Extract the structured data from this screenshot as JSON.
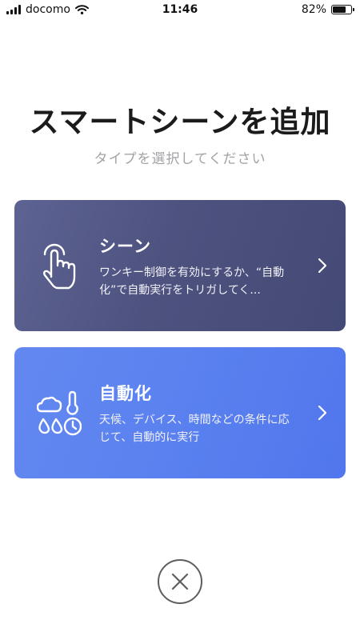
{
  "status_bar": {
    "carrier": "docomo",
    "time": "11:46",
    "battery_percent": "82%",
    "battery_level": 0.82,
    "signal_icon": "cellular-signal-icon",
    "wifi_icon": "wifi-icon",
    "battery_icon": "battery-icon"
  },
  "header": {
    "title": "スマートシーンを追加",
    "subtitle": "タイプを選択してください"
  },
  "cards": [
    {
      "title": "シーン",
      "description": "ワンキー制御を有効にするか、“自動化”で自動実行をトリガしてく...",
      "icon": "tap-hand-icon",
      "color": "#4e527f"
    },
    {
      "title": "自動化",
      "description": "天候、デバイス、時間などの条件に応じて、自動的に実行",
      "icon": "weather-clock-icon",
      "color": "#5a81ef"
    }
  ],
  "close": {
    "icon": "close-icon"
  }
}
